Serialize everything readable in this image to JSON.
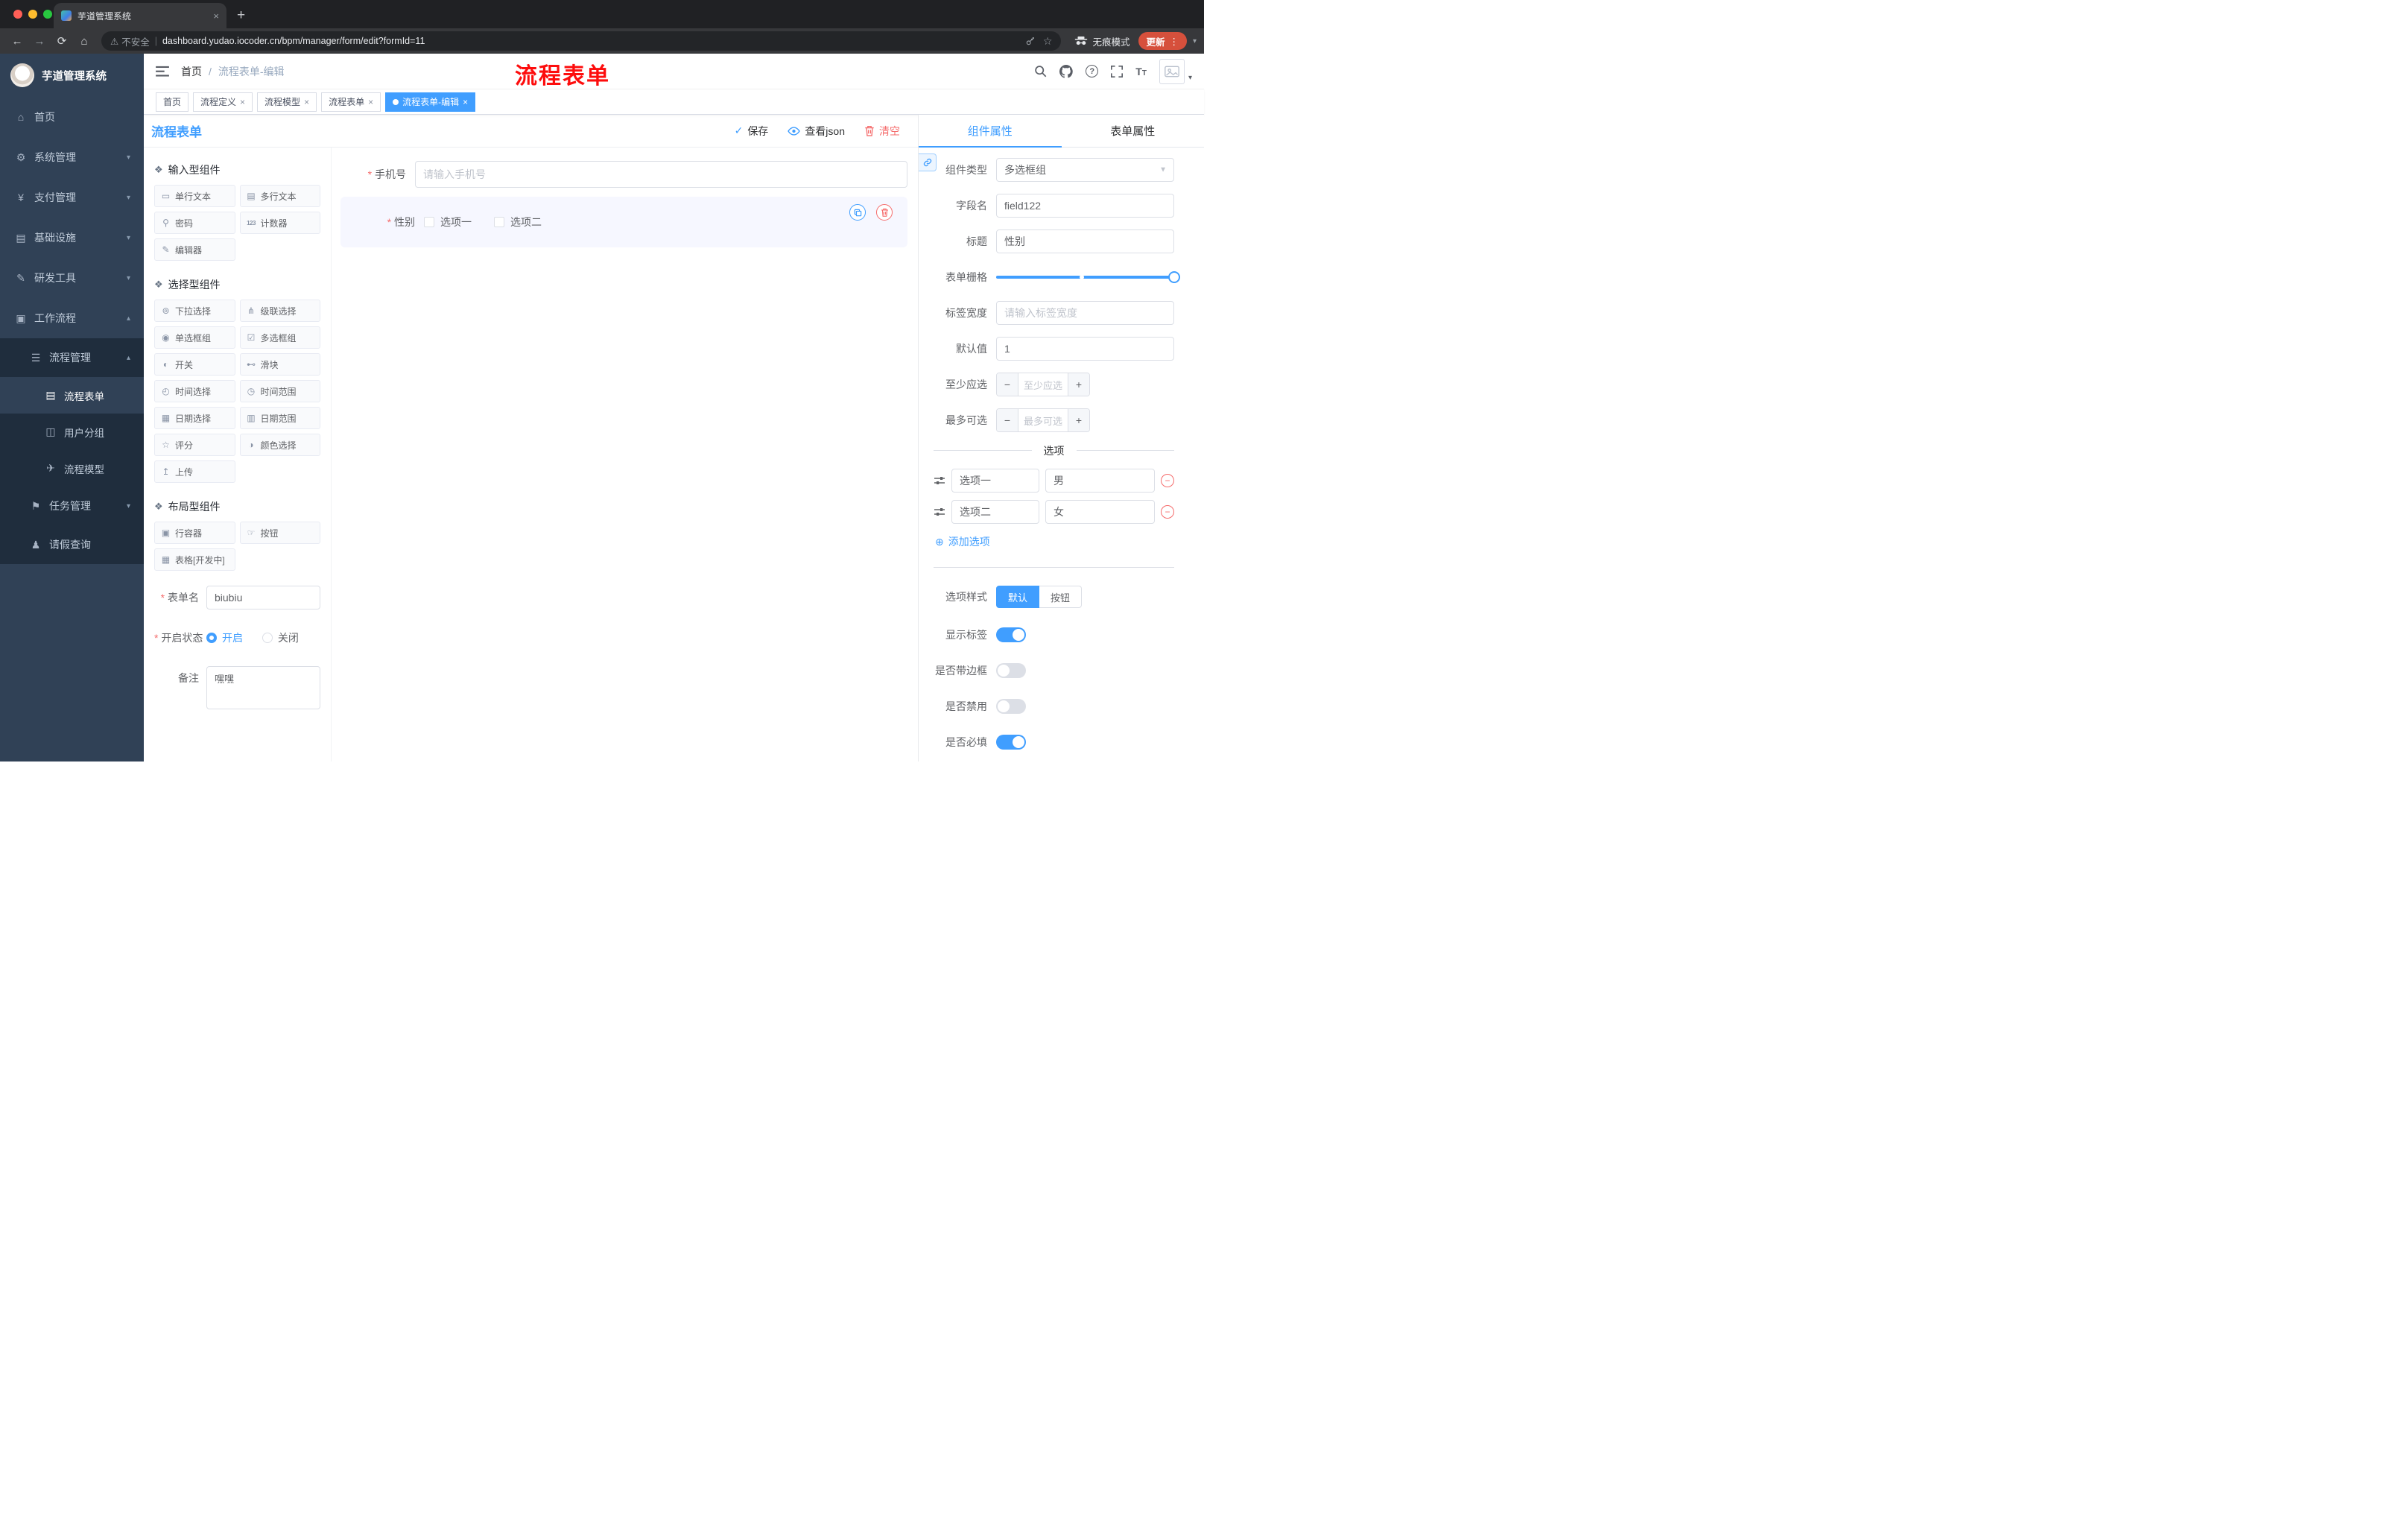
{
  "browser": {
    "tab": {
      "title": "芋道管理系统",
      "close": "×",
      "new_tab": "+"
    },
    "toolbar": {
      "security": "不安全",
      "url": "dashboard.yudao.iocoder.cn/bpm/manager/form/edit?formId=11",
      "incognito": "无痕模式",
      "update": "更新"
    }
  },
  "sidebar": {
    "title": "芋道管理系统",
    "menu": [
      {
        "label": "首页",
        "icon": "dashboard-icon"
      },
      {
        "label": "系统管理",
        "icon": "gear-icon"
      },
      {
        "label": "支付管理",
        "icon": "payment-icon"
      },
      {
        "label": "基础设施",
        "icon": "infrastructure-icon"
      },
      {
        "label": "研发工具",
        "icon": "devtools-icon"
      },
      {
        "label": "工作流程",
        "icon": "workflow-icon"
      }
    ],
    "workflow": {
      "process_management": {
        "label": "流程管理",
        "icon": "process-management-icon"
      },
      "children": [
        {
          "label": "流程表单",
          "icon": "form-icon",
          "active": true
        },
        {
          "label": "用户分组",
          "icon": "user-group-icon"
        },
        {
          "label": "流程模型",
          "icon": "process-model-icon"
        }
      ],
      "task_management": {
        "label": "任务管理",
        "icon": "task-icon"
      },
      "leave_query": {
        "label": "请假查询",
        "icon": "person-icon"
      }
    }
  },
  "header": {
    "breadcrumb": [
      "首页",
      "流程表单-编辑"
    ],
    "separator": "/",
    "annotation": "流程表单"
  },
  "tags": [
    {
      "label": "首页"
    },
    {
      "label": "流程定义",
      "close": "×"
    },
    {
      "label": "流程模型",
      "close": "×"
    },
    {
      "label": "流程表单",
      "close": "×"
    },
    {
      "label": "流程表单-编辑",
      "close": "×",
      "active": true
    }
  ],
  "designer": {
    "title": "流程表单",
    "actions": {
      "save": "保存",
      "view_json": "查看json",
      "clear": "清空"
    },
    "palette": {
      "counter_icon_text": "123",
      "sections": [
        {
          "title": "输入型组件",
          "items": [
            {
              "label": "单行文本",
              "icon": "single-line-text-icon"
            },
            {
              "label": "多行文本",
              "icon": "multi-line-text-icon"
            },
            {
              "label": "密码",
              "icon": "password-icon"
            },
            {
              "label": "计数器",
              "icon": "counter-icon"
            },
            {
              "label": "编辑器",
              "icon": "editor-icon"
            }
          ]
        },
        {
          "title": "选择型组件",
          "items": [
            {
              "label": "下拉选择",
              "icon": "select-icon"
            },
            {
              "label": "级联选择",
              "icon": "cascader-icon"
            },
            {
              "label": "单选框组",
              "icon": "radio-group-icon"
            },
            {
              "label": "多选框组",
              "icon": "checkbox-group-icon"
            },
            {
              "label": "开关",
              "icon": "switch-icon"
            },
            {
              "label": "滑块",
              "icon": "slider-icon"
            },
            {
              "label": "时间选择",
              "icon": "time-picker-icon"
            },
            {
              "label": "时间范围",
              "icon": "time-range-icon"
            },
            {
              "label": "日期选择",
              "icon": "date-picker-icon"
            },
            {
              "label": "日期范围",
              "icon": "date-range-icon"
            },
            {
              "label": "评分",
              "icon": "rate-icon"
            },
            {
              "label": "颜色选择",
              "icon": "color-picker-icon"
            },
            {
              "label": "上传",
              "icon": "upload-icon"
            }
          ]
        },
        {
          "title": "布局型组件",
          "items": [
            {
              "label": "行容器",
              "icon": "row-container-icon"
            },
            {
              "label": "按钮",
              "icon": "button-icon"
            },
            {
              "label": "表格[开发中]",
              "icon": "table-icon"
            }
          ]
        }
      ],
      "form": {
        "name_label": "表单名",
        "name_value": "biubiu",
        "status_label": "开启状态",
        "status_on": "开启",
        "status_off": "关闭",
        "remark_label": "备注",
        "remark_value": "嘿嘿"
      }
    },
    "canvas": {
      "phone": {
        "label": "手机号",
        "placeholder": "请输入手机号"
      },
      "gender": {
        "label": "性别",
        "options": [
          "选项一",
          "选项二"
        ]
      }
    },
    "props": {
      "tabs": [
        "组件属性",
        "表单属性"
      ],
      "fields": {
        "component_type_label": "组件类型",
        "component_type_value": "多选框组",
        "field_name_label": "字段名",
        "field_name_value": "field122",
        "title_label": "标题",
        "title_value": "性别",
        "grid_label": "表单栅格",
        "label_width_label": "标签宽度",
        "label_width_placeholder": "请输入标签宽度",
        "default_label": "默认值",
        "default_value": "1",
        "min_label": "至少应选",
        "min_placeholder": "至少应选",
        "max_label": "最多可选",
        "max_placeholder": "最多可选"
      },
      "options": {
        "divider": "选项",
        "rows": [
          {
            "label": "选项一",
            "value": "男"
          },
          {
            "label": "选项二",
            "value": "女"
          }
        ],
        "add": "添加选项"
      },
      "style": {
        "label": "选项样式",
        "choices": [
          "默认",
          "按钮"
        ],
        "active": "默认"
      },
      "switches": [
        {
          "label": "显示标签",
          "on": true
        },
        {
          "label": "是否带边框",
          "on": false
        },
        {
          "label": "是否禁用",
          "on": false
        },
        {
          "label": "是否必填",
          "on": true
        }
      ]
    }
  },
  "colors": {
    "accent": "#409eff",
    "danger": "#f56c6c",
    "annotation": "#fd0d0d",
    "sidebar_bg": "#304156"
  }
}
